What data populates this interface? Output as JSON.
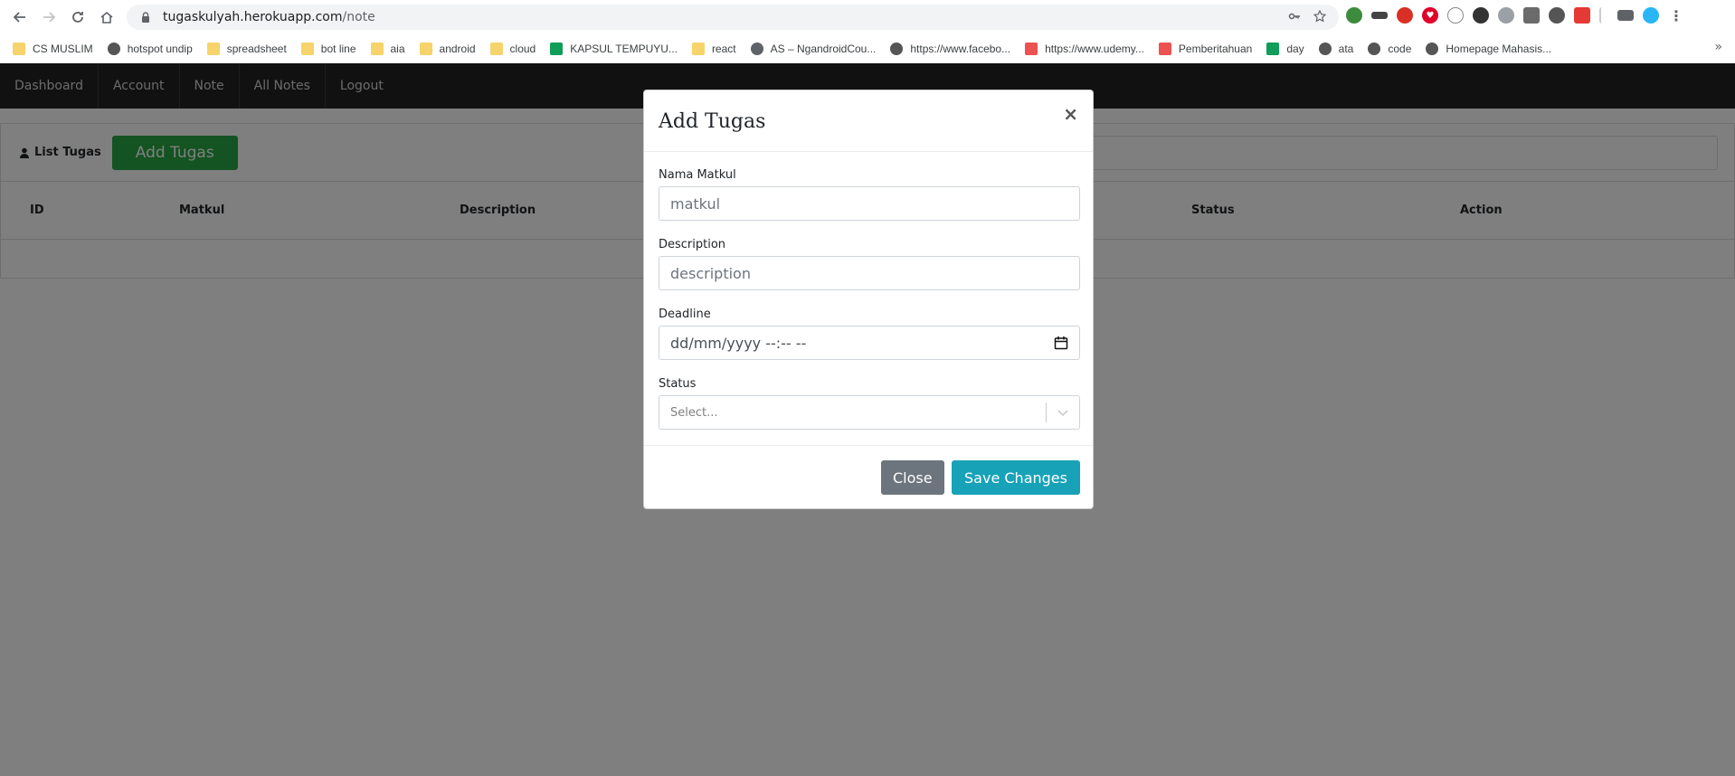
{
  "browser": {
    "url_host": "tugaskulyah.herokuapp.com",
    "url_path": "/note",
    "bookmarks": [
      {
        "label": "CS MUSLIM",
        "icon": "folder-icon"
      },
      {
        "label": "hotspot undip",
        "icon": "site-icon"
      },
      {
        "label": "spreadsheet",
        "icon": "folder-icon"
      },
      {
        "label": "bot line",
        "icon": "folder-icon"
      },
      {
        "label": "aia",
        "icon": "folder-icon"
      },
      {
        "label": "android",
        "icon": "folder-icon"
      },
      {
        "label": "cloud",
        "icon": "folder-icon"
      },
      {
        "label": "KAPSUL TEMPUYU...",
        "icon": "sheets-icon"
      },
      {
        "label": "react",
        "icon": "folder-icon"
      },
      {
        "label": "AS – NgandroidCou...",
        "icon": "globe-icon"
      },
      {
        "label": "https://www.facebo...",
        "icon": "site-icon"
      },
      {
        "label": "https://www.udemy...",
        "icon": "udemy-icon"
      },
      {
        "label": "Pemberitahuan",
        "icon": "udemy-icon"
      },
      {
        "label": "day",
        "icon": "sheets-icon"
      },
      {
        "label": "ata",
        "icon": "site-icon"
      },
      {
        "label": "code",
        "icon": "site-icon"
      },
      {
        "label": "Homepage Mahasis...",
        "icon": "site-icon"
      }
    ],
    "more_label": "»"
  },
  "nav": {
    "items": [
      "Dashboard",
      "Account",
      "Note",
      "All Notes",
      "Logout"
    ]
  },
  "card": {
    "title": "List Tugas",
    "add_button": "Add Tugas",
    "columns": [
      "ID",
      "Matkul",
      "Description",
      "Status",
      "Action"
    ]
  },
  "modal": {
    "title": "Add Tugas",
    "close_x": "×",
    "fields": {
      "matkul_label": "Nama Matkul",
      "matkul_placeholder": "matkul",
      "description_label": "Description",
      "description_placeholder": "description",
      "deadline_label": "Deadline",
      "deadline_placeholder": "dd/mm/yyyy --:-- --",
      "status_label": "Status",
      "status_placeholder": "Select..."
    },
    "close_button": "Close",
    "save_button": "Save Changes"
  },
  "colors": {
    "navbar": "#222222",
    "add_button": "#28a745",
    "save_button": "#17a2b8",
    "close_button": "#6c757d"
  }
}
